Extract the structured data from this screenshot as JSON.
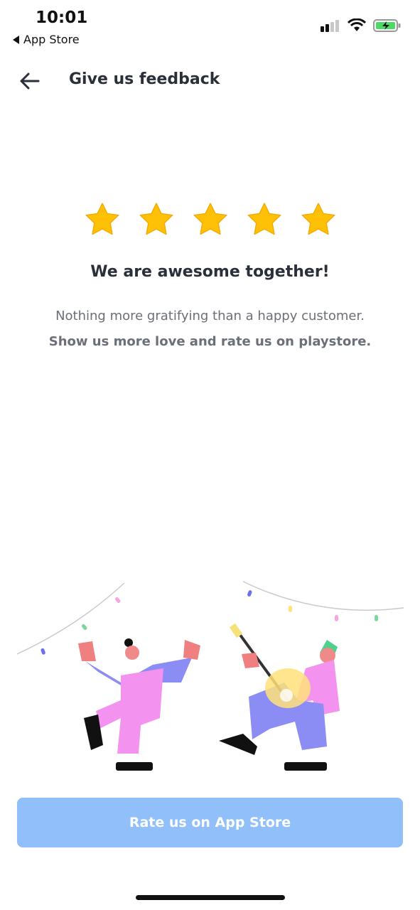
{
  "status_bar": {
    "time": "10:01",
    "back_app_label": "App Store",
    "icons": [
      "signal-icon",
      "wifi-icon",
      "battery-charging-icon"
    ]
  },
  "header": {
    "title": "Give us feedback",
    "back_icon": "arrow-left-icon"
  },
  "rating": {
    "stars_selected": 5,
    "stars_total": 5,
    "star_color": "#FFC107"
  },
  "message": {
    "headline": "We are awesome together!",
    "line1": "Nothing more gratifying than a happy customer.",
    "line2": "Show us more love and rate us on playstore."
  },
  "illustration": {
    "name": "celebration-illustration",
    "description_icon": "dancing-people-illustration"
  },
  "cta": {
    "label": "Rate us on App Store",
    "color": "#90BFF9"
  }
}
